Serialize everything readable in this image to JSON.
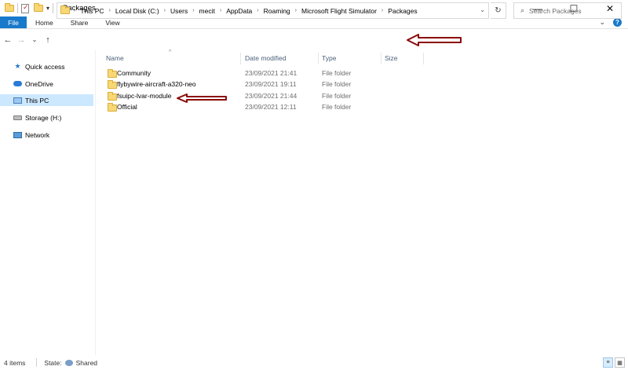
{
  "window": {
    "title": "Packages",
    "controls": {
      "minimize": "—",
      "maximize": "☐",
      "close": "✕"
    }
  },
  "ribbon": {
    "tabs": [
      "File",
      "Home",
      "Share",
      "View"
    ],
    "expand_glyph": "⌄",
    "help_glyph": "?"
  },
  "nav": {
    "back": "←",
    "forward": "→",
    "recent": "⌄",
    "up": "↑"
  },
  "address": {
    "crumbs": [
      "This PC",
      "Local Disk (C:)",
      "Users",
      "mecit",
      "AppData",
      "Roaming",
      "Microsoft Flight Simulator",
      "Packages"
    ],
    "separator": "›",
    "dropdown_glyph": "⌄",
    "refresh_glyph": "↻"
  },
  "search": {
    "placeholder": "Search Packages",
    "icon": "search-icon",
    "glyph": "⌕"
  },
  "sidebar": {
    "items": [
      {
        "label": "Quick access",
        "icon": "star-icon",
        "selected": false
      },
      {
        "label": "OneDrive",
        "icon": "cloud-icon",
        "selected": false
      },
      {
        "label": "This PC",
        "icon": "computer-icon",
        "selected": true
      },
      {
        "label": "Storage (H:)",
        "icon": "drive-icon",
        "selected": false
      },
      {
        "label": "Network",
        "icon": "network-icon",
        "selected": false
      }
    ]
  },
  "columns": {
    "name": "Name",
    "date": "Date modified",
    "type": "Type",
    "size": "Size",
    "sort_glyph": "^"
  },
  "files": [
    {
      "name": "Community",
      "date": "23/09/2021 21:41",
      "type": "File folder"
    },
    {
      "name": "flybywire-aircraft-a320-neo",
      "date": "23/09/2021 19:11",
      "type": "File folder"
    },
    {
      "name": "fsuipc-lvar-module",
      "date": "23/09/2021 21:44",
      "type": "File folder"
    },
    {
      "name": "Official",
      "date": "23/09/2021 12:11",
      "type": "File folder"
    }
  ],
  "status": {
    "items": "4 items",
    "state_label": "State:",
    "state_value": "Shared"
  },
  "colors": {
    "accent": "#1979ca",
    "selection": "#cce8ff",
    "annotation_arrow": "#8b0a0a",
    "folder": "#f8d775"
  }
}
